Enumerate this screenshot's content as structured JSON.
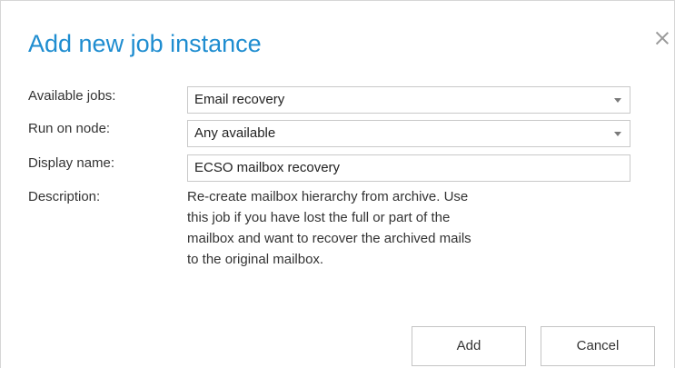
{
  "dialog": {
    "title": "Add new job instance",
    "close_icon": "close-icon",
    "title_color": "#1f8dd0"
  },
  "form": {
    "available_jobs": {
      "label": "Available jobs:",
      "value": "Email recovery"
    },
    "run_on_node": {
      "label": "Run on node:",
      "value": "Any available"
    },
    "display_name": {
      "label": "Display name:",
      "value": "ECSO mailbox recovery"
    },
    "description": {
      "label": "Description:",
      "lines": [
        "Re-create mailbox hierarchy from archive. Use",
        "this job if you have lost the full or part of the",
        "mailbox and want to recover the archived mails",
        "to the original mailbox."
      ]
    }
  },
  "buttons": {
    "add_label": "Add",
    "cancel_label": "Cancel"
  }
}
